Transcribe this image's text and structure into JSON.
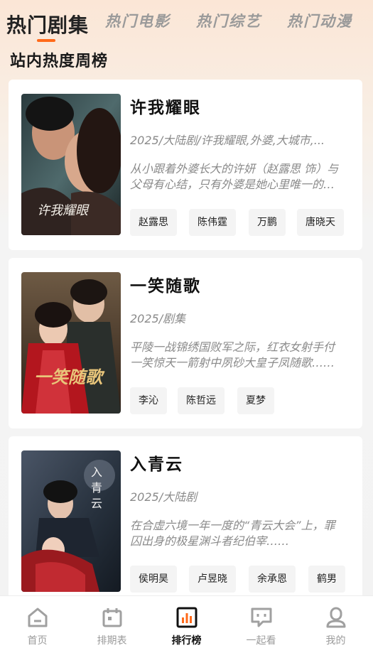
{
  "tabs": [
    {
      "label": "热门剧集",
      "active": true
    },
    {
      "label": "热门电影",
      "active": false
    },
    {
      "label": "热门综艺",
      "active": false
    },
    {
      "label": "热门动漫",
      "active": false
    }
  ],
  "accent_color": "#ff6a1a",
  "section_title": "站内热度周榜",
  "items": [
    {
      "title": "许我耀眼",
      "meta": "2025/大陆剧/许我耀眼,外婆,大城市,...",
      "desc": "从小跟着外婆长大的许妍（赵露思 饰）与父母有心结，只有外婆是她心里唯一的牵挂……",
      "poster_caption": "许我耀眼",
      "actors": [
        "赵露思",
        "陈伟霆",
        "万鹏",
        "唐晓天"
      ]
    },
    {
      "title": "一笑随歌",
      "meta": "2025/剧集",
      "desc": "平陵一战锦绣国败军之际，红衣女射手付一笑惊天一箭射中夙砂大皇子凤随歌……",
      "poster_caption": "一笑随歌",
      "actors": [
        "李沁",
        "陈哲远",
        "夏梦"
      ]
    },
    {
      "title": "入青云",
      "meta": "2025/大陆剧",
      "desc": "在合虚六境一年一度的“青云大会”上，罪囚出身的极星渊斗者纪伯宰……",
      "poster_caption": "入青云",
      "actors": [
        "侯明昊",
        "卢昱晓",
        "余承恩",
        "鹤男"
      ]
    }
  ],
  "bottom_nav": [
    {
      "label": "首页",
      "icon": "home-icon",
      "active": false
    },
    {
      "label": "排期表",
      "icon": "calendar-icon",
      "active": false
    },
    {
      "label": "排行榜",
      "icon": "ranking-chart-icon",
      "active": true
    },
    {
      "label": "一起看",
      "icon": "chat-bubble-icon",
      "active": false
    },
    {
      "label": "我的",
      "icon": "user-icon",
      "active": false
    }
  ]
}
